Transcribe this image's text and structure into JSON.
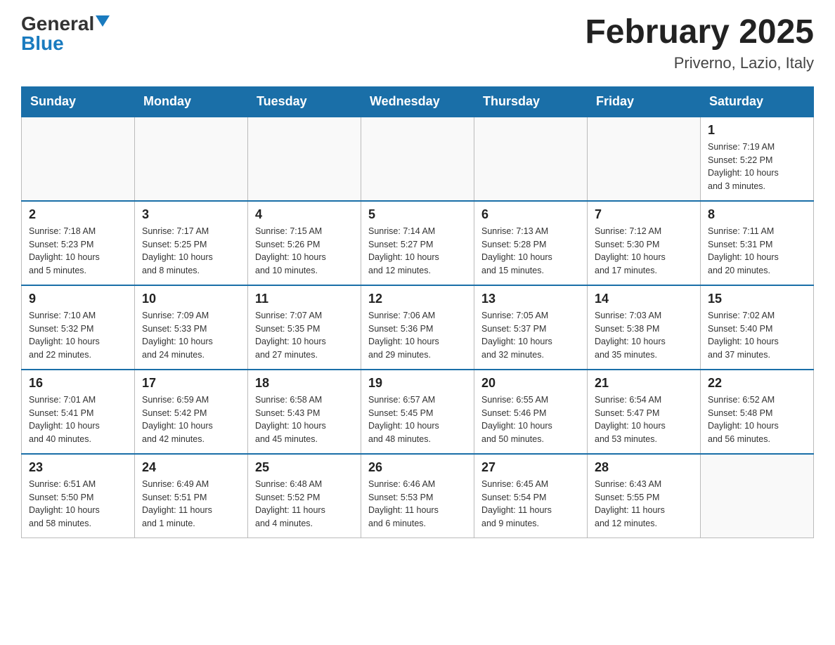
{
  "logo": {
    "general": "General",
    "blue": "Blue"
  },
  "title": "February 2025",
  "location": "Priverno, Lazio, Italy",
  "days_of_week": [
    "Sunday",
    "Monday",
    "Tuesday",
    "Wednesday",
    "Thursday",
    "Friday",
    "Saturday"
  ],
  "weeks": [
    [
      {
        "day": "",
        "info": []
      },
      {
        "day": "",
        "info": []
      },
      {
        "day": "",
        "info": []
      },
      {
        "day": "",
        "info": []
      },
      {
        "day": "",
        "info": []
      },
      {
        "day": "",
        "info": []
      },
      {
        "day": "1",
        "info": [
          "Sunrise: 7:19 AM",
          "Sunset: 5:22 PM",
          "Daylight: 10 hours",
          "and 3 minutes."
        ]
      }
    ],
    [
      {
        "day": "2",
        "info": [
          "Sunrise: 7:18 AM",
          "Sunset: 5:23 PM",
          "Daylight: 10 hours",
          "and 5 minutes."
        ]
      },
      {
        "day": "3",
        "info": [
          "Sunrise: 7:17 AM",
          "Sunset: 5:25 PM",
          "Daylight: 10 hours",
          "and 8 minutes."
        ]
      },
      {
        "day": "4",
        "info": [
          "Sunrise: 7:15 AM",
          "Sunset: 5:26 PM",
          "Daylight: 10 hours",
          "and 10 minutes."
        ]
      },
      {
        "day": "5",
        "info": [
          "Sunrise: 7:14 AM",
          "Sunset: 5:27 PM",
          "Daylight: 10 hours",
          "and 12 minutes."
        ]
      },
      {
        "day": "6",
        "info": [
          "Sunrise: 7:13 AM",
          "Sunset: 5:28 PM",
          "Daylight: 10 hours",
          "and 15 minutes."
        ]
      },
      {
        "day": "7",
        "info": [
          "Sunrise: 7:12 AM",
          "Sunset: 5:30 PM",
          "Daylight: 10 hours",
          "and 17 minutes."
        ]
      },
      {
        "day": "8",
        "info": [
          "Sunrise: 7:11 AM",
          "Sunset: 5:31 PM",
          "Daylight: 10 hours",
          "and 20 minutes."
        ]
      }
    ],
    [
      {
        "day": "9",
        "info": [
          "Sunrise: 7:10 AM",
          "Sunset: 5:32 PM",
          "Daylight: 10 hours",
          "and 22 minutes."
        ]
      },
      {
        "day": "10",
        "info": [
          "Sunrise: 7:09 AM",
          "Sunset: 5:33 PM",
          "Daylight: 10 hours",
          "and 24 minutes."
        ]
      },
      {
        "day": "11",
        "info": [
          "Sunrise: 7:07 AM",
          "Sunset: 5:35 PM",
          "Daylight: 10 hours",
          "and 27 minutes."
        ]
      },
      {
        "day": "12",
        "info": [
          "Sunrise: 7:06 AM",
          "Sunset: 5:36 PM",
          "Daylight: 10 hours",
          "and 29 minutes."
        ]
      },
      {
        "day": "13",
        "info": [
          "Sunrise: 7:05 AM",
          "Sunset: 5:37 PM",
          "Daylight: 10 hours",
          "and 32 minutes."
        ]
      },
      {
        "day": "14",
        "info": [
          "Sunrise: 7:03 AM",
          "Sunset: 5:38 PM",
          "Daylight: 10 hours",
          "and 35 minutes."
        ]
      },
      {
        "day": "15",
        "info": [
          "Sunrise: 7:02 AM",
          "Sunset: 5:40 PM",
          "Daylight: 10 hours",
          "and 37 minutes."
        ]
      }
    ],
    [
      {
        "day": "16",
        "info": [
          "Sunrise: 7:01 AM",
          "Sunset: 5:41 PM",
          "Daylight: 10 hours",
          "and 40 minutes."
        ]
      },
      {
        "day": "17",
        "info": [
          "Sunrise: 6:59 AM",
          "Sunset: 5:42 PM",
          "Daylight: 10 hours",
          "and 42 minutes."
        ]
      },
      {
        "day": "18",
        "info": [
          "Sunrise: 6:58 AM",
          "Sunset: 5:43 PM",
          "Daylight: 10 hours",
          "and 45 minutes."
        ]
      },
      {
        "day": "19",
        "info": [
          "Sunrise: 6:57 AM",
          "Sunset: 5:45 PM",
          "Daylight: 10 hours",
          "and 48 minutes."
        ]
      },
      {
        "day": "20",
        "info": [
          "Sunrise: 6:55 AM",
          "Sunset: 5:46 PM",
          "Daylight: 10 hours",
          "and 50 minutes."
        ]
      },
      {
        "day": "21",
        "info": [
          "Sunrise: 6:54 AM",
          "Sunset: 5:47 PM",
          "Daylight: 10 hours",
          "and 53 minutes."
        ]
      },
      {
        "day": "22",
        "info": [
          "Sunrise: 6:52 AM",
          "Sunset: 5:48 PM",
          "Daylight: 10 hours",
          "and 56 minutes."
        ]
      }
    ],
    [
      {
        "day": "23",
        "info": [
          "Sunrise: 6:51 AM",
          "Sunset: 5:50 PM",
          "Daylight: 10 hours",
          "and 58 minutes."
        ]
      },
      {
        "day": "24",
        "info": [
          "Sunrise: 6:49 AM",
          "Sunset: 5:51 PM",
          "Daylight: 11 hours",
          "and 1 minute."
        ]
      },
      {
        "day": "25",
        "info": [
          "Sunrise: 6:48 AM",
          "Sunset: 5:52 PM",
          "Daylight: 11 hours",
          "and 4 minutes."
        ]
      },
      {
        "day": "26",
        "info": [
          "Sunrise: 6:46 AM",
          "Sunset: 5:53 PM",
          "Daylight: 11 hours",
          "and 6 minutes."
        ]
      },
      {
        "day": "27",
        "info": [
          "Sunrise: 6:45 AM",
          "Sunset: 5:54 PM",
          "Daylight: 11 hours",
          "and 9 minutes."
        ]
      },
      {
        "day": "28",
        "info": [
          "Sunrise: 6:43 AM",
          "Sunset: 5:55 PM",
          "Daylight: 11 hours",
          "and 12 minutes."
        ]
      },
      {
        "day": "",
        "info": []
      }
    ]
  ]
}
